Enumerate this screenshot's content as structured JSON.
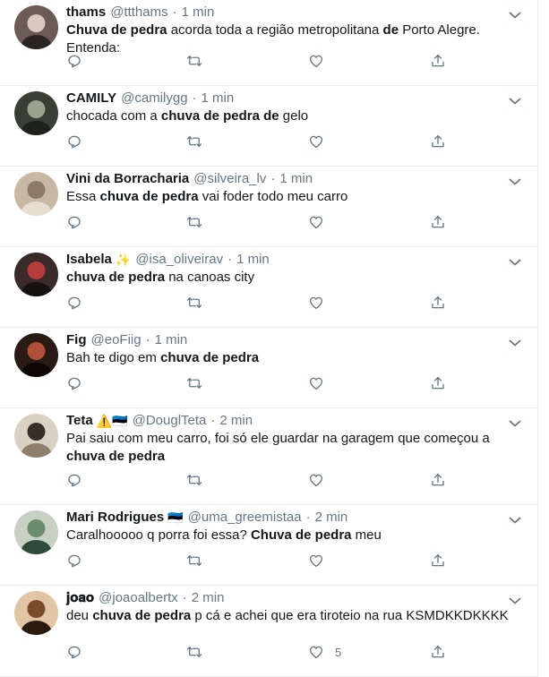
{
  "tweets": [
    {
      "name": "thams",
      "emoji": "",
      "handle": "@ttthams",
      "time": "1 min",
      "text": [
        {
          "t": "Chuva de pedra",
          "b": true
        },
        {
          "t": " acorda toda a região metropolitana ",
          "b": false
        },
        {
          "t": "de",
          "b": true
        },
        {
          "t": " Porto Alegre. Entenda:",
          "b": false
        }
      ],
      "likes": ""
    },
    {
      "name": "CAMILY",
      "emoji": "",
      "handle": "@camilygg",
      "time": "1 min",
      "text": [
        {
          "t": "chocada com a ",
          "b": false
        },
        {
          "t": "chuva de pedra de",
          "b": true
        },
        {
          "t": " gelo",
          "b": false
        }
      ],
      "likes": ""
    },
    {
      "name": "Vini da Borracharia",
      "emoji": "",
      "handle": "@silveira_lv",
      "time": "1 min",
      "text": [
        {
          "t": "Essa ",
          "b": false
        },
        {
          "t": "chuva de pedra",
          "b": true
        },
        {
          "t": " vai foder todo meu carro",
          "b": false
        }
      ],
      "likes": ""
    },
    {
      "name": "Isabela",
      "emoji": "✨",
      "handle": "@isa_oliveirav",
      "time": "1 min",
      "text": [
        {
          "t": "chuva de pedra",
          "b": true
        },
        {
          "t": " na canoas city",
          "b": false
        }
      ],
      "likes": ""
    },
    {
      "name": "Fig",
      "emoji": "",
      "handle": "@eoFiig",
      "time": "1 min",
      "text": [
        {
          "t": "Bah te digo em ",
          "b": false
        },
        {
          "t": "chuva de pedra",
          "b": true
        }
      ],
      "likes": ""
    },
    {
      "name": "Teta",
      "emoji": "⚠️🇪🇪",
      "handle": "@DouglTeta",
      "time": "2 min",
      "text": [
        {
          "t": "Pai saiu com meu carro, foi só ele guardar na garagem que começou a ",
          "b": false
        },
        {
          "t": "chuva de pedra",
          "b": true
        }
      ],
      "likes": ""
    },
    {
      "name": "Mari Rodrigues",
      "emoji": "🇪🇪",
      "handle": "@uma_greemistaa",
      "time": "2 min",
      "text": [
        {
          "t": "Caralhooooo q porra foi essa? ",
          "b": false
        },
        {
          "t": "Chuva de pedra",
          "b": true
        },
        {
          "t": " meu",
          "b": false
        }
      ],
      "likes": ""
    },
    {
      "name": "𝐣𝐨𝐚𝐨",
      "emoji": "",
      "handle": "@joaoalbertx",
      "time": "2 min",
      "text": [
        {
          "t": "deu ",
          "b": false
        },
        {
          "t": "chuva de pedra",
          "b": true
        },
        {
          "t": " p cá e achei que era tiroteio na rua KSMDKKDKKKK",
          "b": false
        }
      ],
      "likes": "5"
    }
  ],
  "colors": {
    "text": "#14171a",
    "secondary": "#657786",
    "border": "#e6ecf0"
  },
  "icons": {
    "reply": "reply-icon",
    "retweet": "retweet-icon",
    "like": "like-icon",
    "share": "share-icon",
    "more": "chevron-down-icon"
  }
}
